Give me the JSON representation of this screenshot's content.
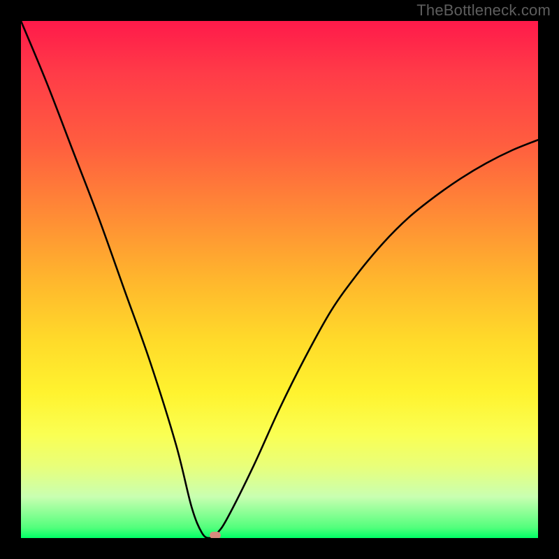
{
  "watermark": "TheBottleneck.com",
  "chart_data": {
    "type": "line",
    "title": "",
    "xlabel": "",
    "ylabel": "",
    "xlim": [
      0,
      100
    ],
    "ylim": [
      0,
      100
    ],
    "grid": false,
    "legend": null,
    "background_gradient": {
      "top_color": "#ff1a4a",
      "bottom_color": "#00ff66",
      "stops": [
        {
          "pos": 0.0,
          "color": "#ff1a4a"
        },
        {
          "pos": 0.24,
          "color": "#ff5e3f"
        },
        {
          "pos": 0.5,
          "color": "#ffb62d"
        },
        {
          "pos": 0.72,
          "color": "#fff32f"
        },
        {
          "pos": 0.92,
          "color": "#c9ffb1"
        },
        {
          "pos": 1.0,
          "color": "#00ff66"
        }
      ]
    },
    "series": [
      {
        "name": "bottleneck-curve",
        "x": [
          0,
          5,
          10,
          15,
          20,
          25,
          30,
          33,
          35,
          36.5,
          38,
          40,
          45,
          50,
          55,
          60,
          65,
          70,
          75,
          80,
          85,
          90,
          95,
          100
        ],
        "y": [
          100,
          88,
          75,
          62,
          48,
          34,
          18,
          6,
          1,
          0,
          1,
          4,
          14,
          25,
          35,
          44,
          51,
          57,
          62,
          66,
          69.5,
          72.5,
          75,
          77
        ]
      }
    ],
    "marker": {
      "name": "optimal-point",
      "x": 37.5,
      "y": 0.5,
      "color": "#d88a7e"
    }
  }
}
